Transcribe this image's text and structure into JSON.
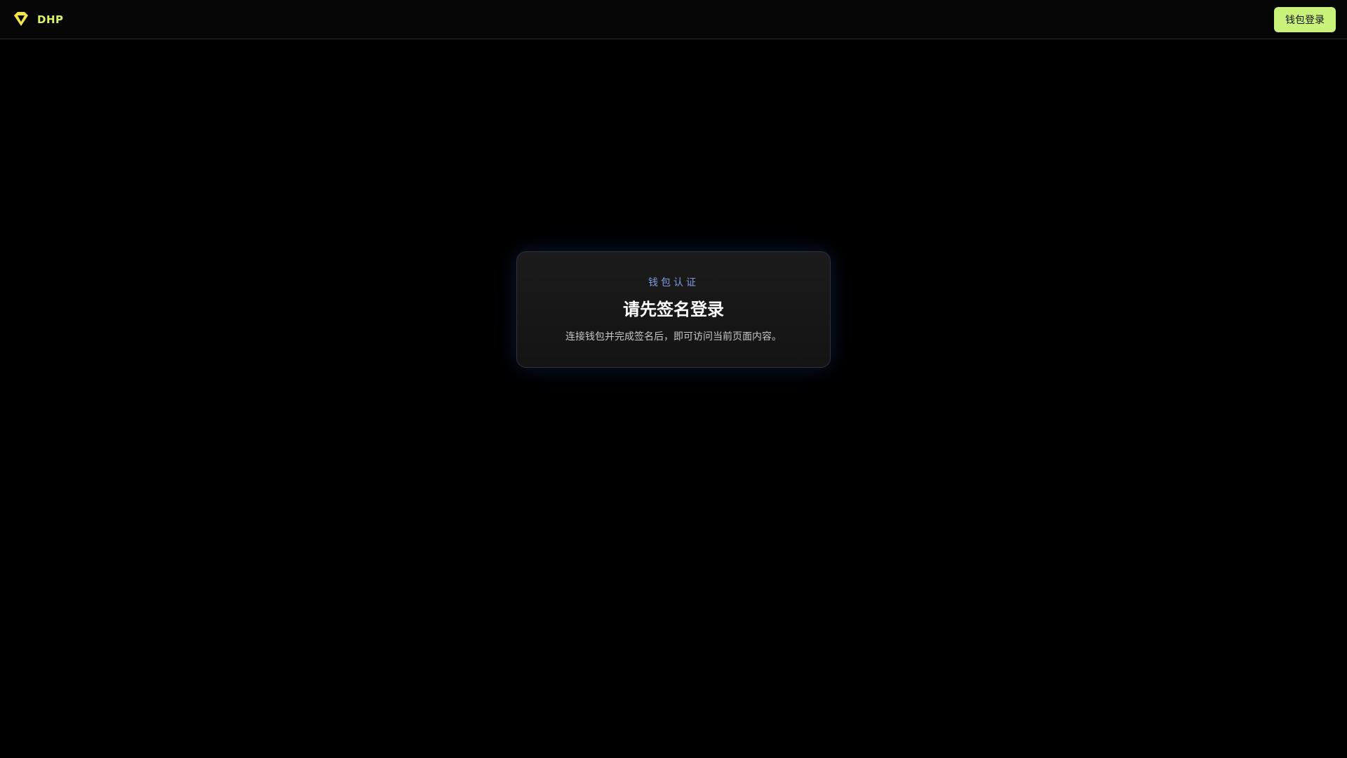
{
  "header": {
    "brand_name": "DHP",
    "brand_icon": "diamond-logo-icon",
    "login_label": "钱包登录"
  },
  "card": {
    "eyebrow": "钱包认证",
    "title": "请先签名登录",
    "description": "连接钱包并完成签名后，即可访问当前页面内容。"
  },
  "colors": {
    "background": "#000000",
    "brand_accent": "#d7f36a",
    "logo_yellow": "#f5e34a",
    "button_bg": "#c9f27a",
    "eyebrow": "#7f9be0",
    "card_border": "#2b3445"
  }
}
